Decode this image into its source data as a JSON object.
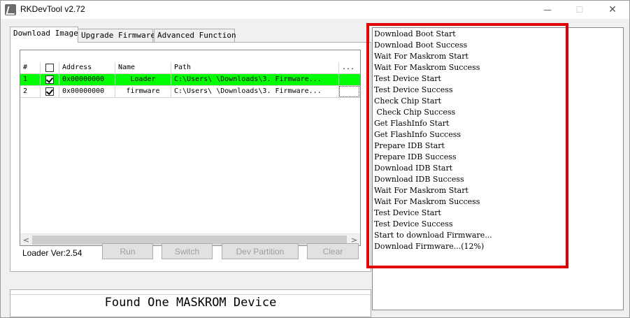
{
  "window": {
    "title": "RKDevTool v2.72",
    "min_glyph": "—",
    "max_glyph": "☐",
    "close_glyph": "✕"
  },
  "tabs": [
    {
      "label": "Download Image",
      "active": true
    },
    {
      "label": "Upgrade Firmware",
      "active": false
    },
    {
      "label": "Advanced Function",
      "active": false
    }
  ],
  "grid": {
    "headers": [
      "#",
      "",
      "Address",
      "Name",
      "Path",
      "..."
    ],
    "rows": [
      {
        "num": "1",
        "checked": true,
        "address": "0x00000000",
        "name": "Loader",
        "path": "C:\\Users\\       \\Downloads\\3. Firmware...",
        "selected": true
      },
      {
        "num": "2",
        "checked": true,
        "address": "0x00000000",
        "name": "firmware",
        "path": "C:\\Users\\       \\Downloads\\3. Firmware...",
        "selected": false
      }
    ],
    "scroll_left": "<",
    "scroll_right": ">"
  },
  "loader_version": "Loader Ver:2.54",
  "buttons": {
    "run": "Run",
    "switch": "Switch",
    "dev_partition": "Dev Partition",
    "clear": "Clear"
  },
  "status_text": "Found One MASKROM Device",
  "log": [
    "Download Boot Start",
    "Download Boot Success",
    "Wait For Maskrom Start",
    "Wait For Maskrom Success",
    "Test Device Start",
    "Test Device Success",
    "Check Chip Start",
    " Check Chip Success",
    "Get FlashInfo Start",
    "Get FlashInfo Success",
    "Prepare IDB Start",
    "Prepare IDB Success",
    "Download IDB Start",
    "Download IDB Success",
    "Wait For Maskrom Start",
    "Wait For Maskrom Success",
    "Test Device Start",
    "Test Device Success",
    "Start to download Firmware...",
    "Download Firmware...(12%)"
  ],
  "colors": {
    "selected_row": "#00ff00",
    "highlight_box": "#e00000"
  }
}
